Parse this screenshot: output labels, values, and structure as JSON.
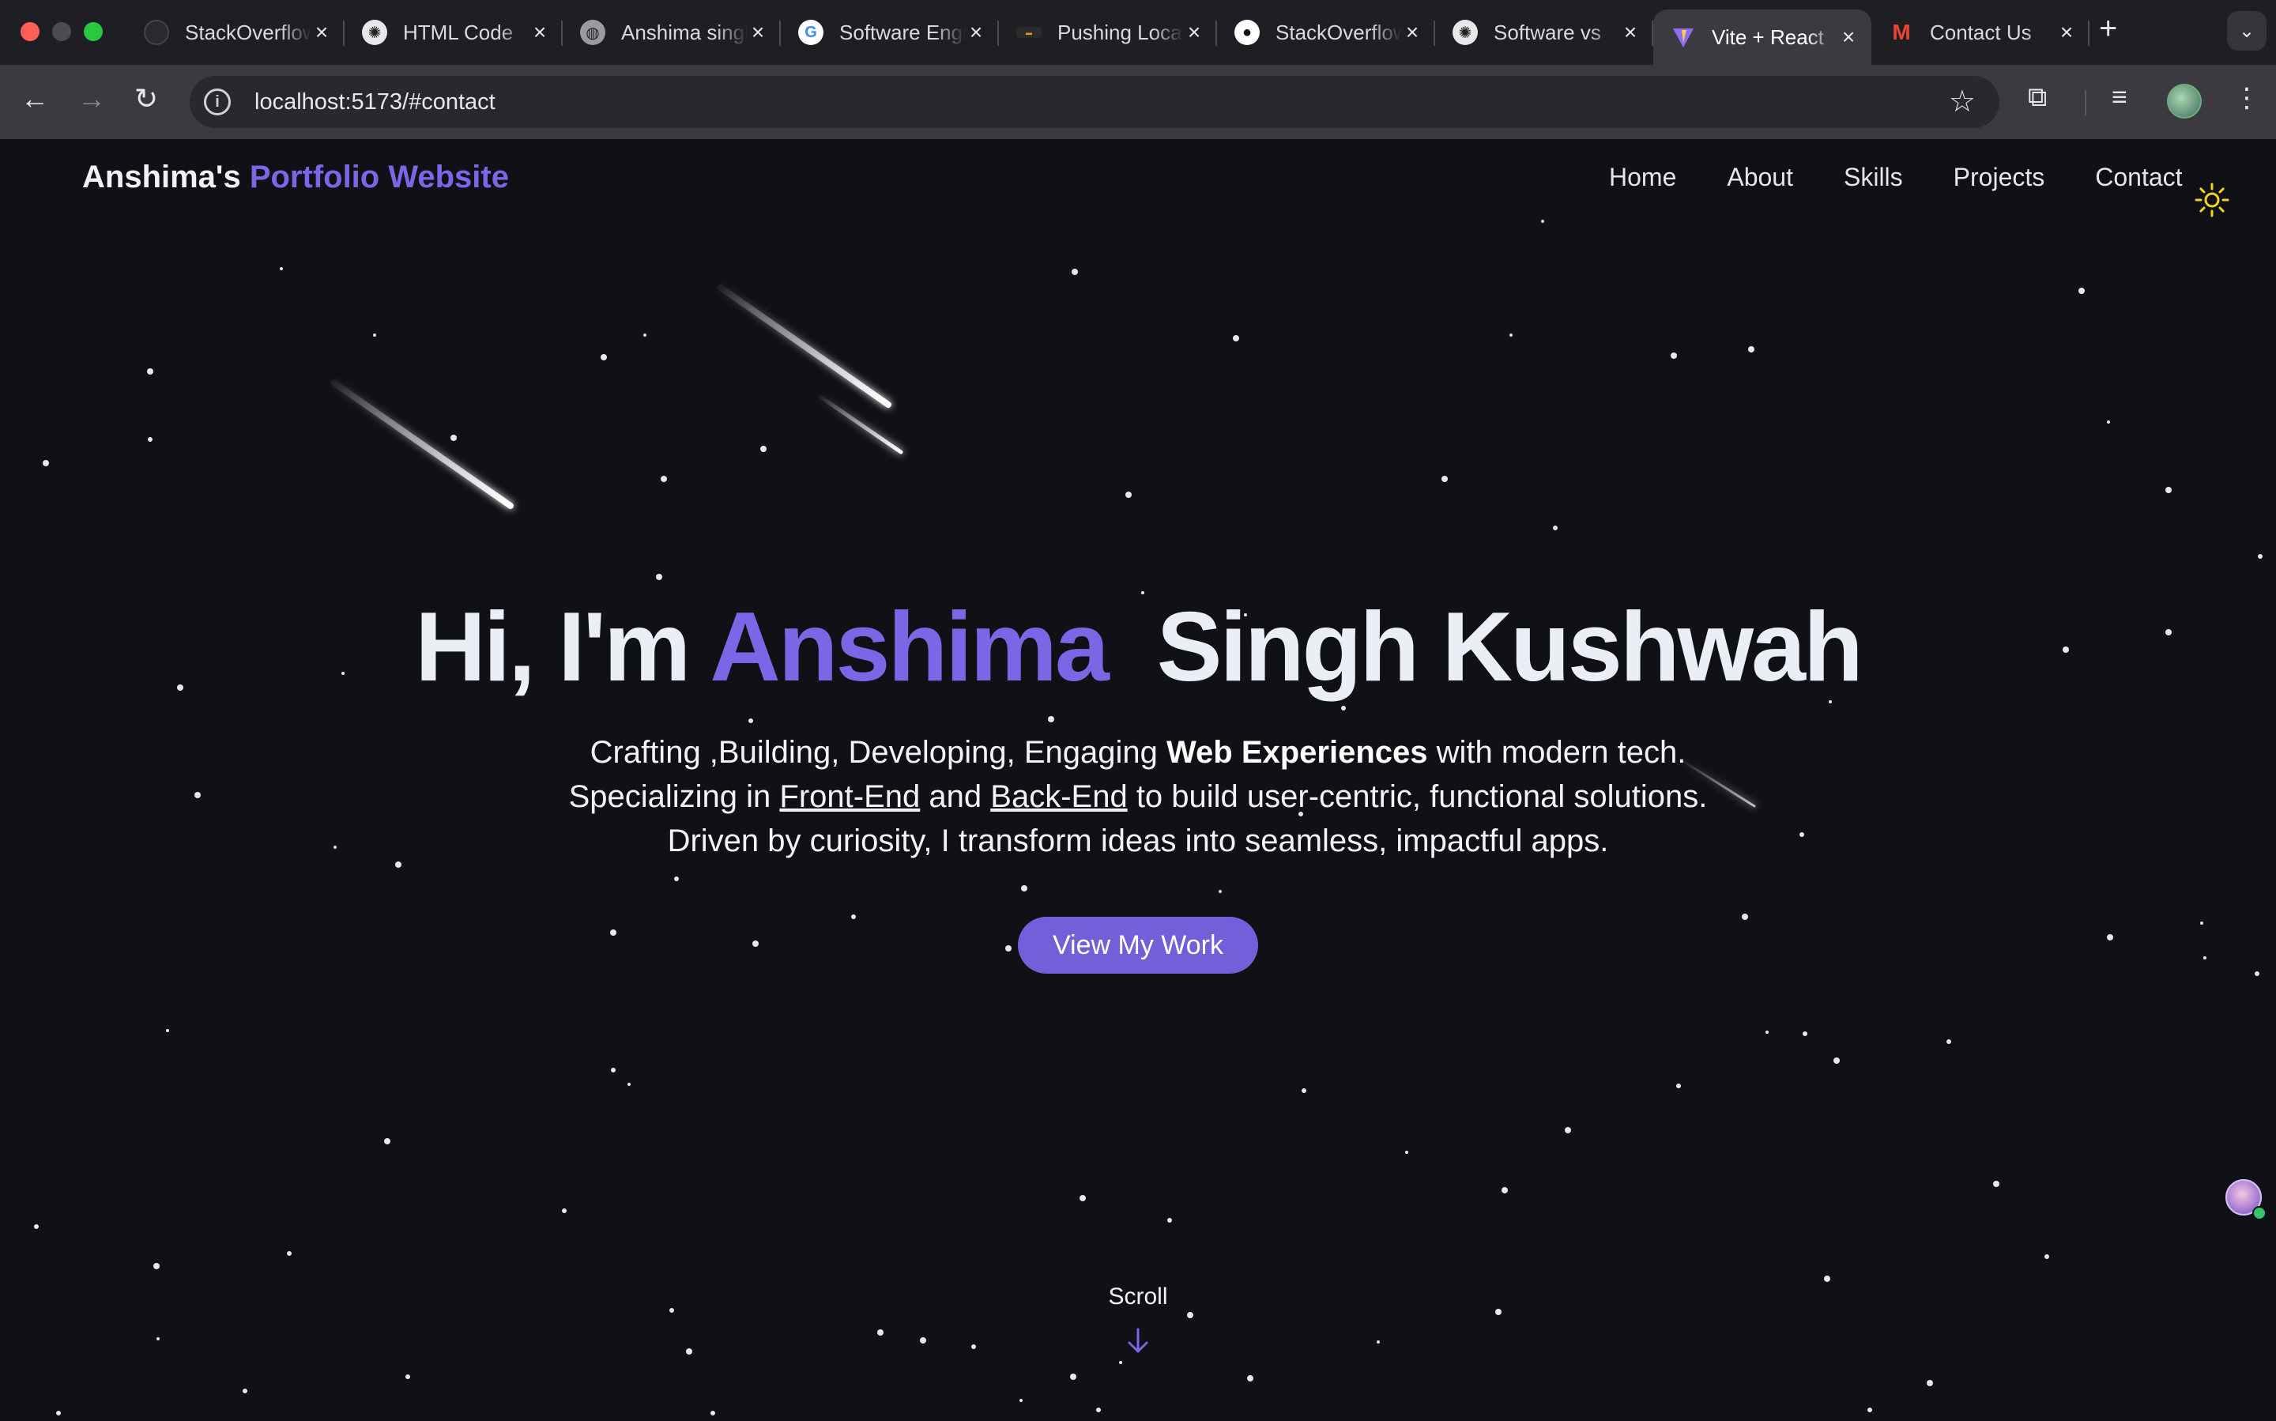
{
  "browser": {
    "tabs": [
      {
        "title": "StackOverflow",
        "favicon": "stackoverflow-icon",
        "active": false
      },
      {
        "title": "HTML Code",
        "favicon": "chatgpt-icon",
        "active": false
      },
      {
        "title": "Anshima singh",
        "favicon": "globe-icon",
        "active": false
      },
      {
        "title": "Software Engineer",
        "favicon": "google-icon",
        "active": false
      },
      {
        "title": "Pushing Local",
        "favicon": "codegrepper-icon",
        "active": false
      },
      {
        "title": "StackOverflow",
        "favicon": "github-icon",
        "active": false
      },
      {
        "title": "Software vs",
        "favicon": "chatgpt-icon",
        "active": false
      },
      {
        "title": "Vite + React",
        "favicon": "vite-icon",
        "active": true
      },
      {
        "title": "Contact Us",
        "favicon": "gmail-icon",
        "active": false
      }
    ],
    "new_tab": "+",
    "tab_menu": "⌄",
    "url": "localhost:5173/#contact"
  },
  "site": {
    "logo_name": "Anshima's",
    "logo_accent": "Portfolio Website",
    "nav": {
      "home": "Home",
      "about": "About",
      "skills": "Skills",
      "projects": "Projects",
      "contact": "Contact"
    },
    "theme_toggle_icon": "sun-icon"
  },
  "hero": {
    "greeting": "Hi, I'm",
    "first_name": "Anshima",
    "last_name": "Singh Kushwah",
    "line1_pre": "Crafting ,Building, Developing, Engaging",
    "line1_bold": "Web Experiences",
    "line1_post": "with modern tech.",
    "line2_pre": "Specializing in",
    "line2_link1": "Front-End",
    "line2_mid": "and",
    "line2_link2": "Back-End",
    "line2_post": "to build user-centric, functional solutions.",
    "line3": "Driven by curiosity, I transform ideas into seamless, impactful apps.",
    "cta_label": "View My Work",
    "scroll_label": "Scroll"
  },
  "colors": {
    "accent": "#7b67e6",
    "button": "#7360d9",
    "background": "#0f1117",
    "sun": "#f5d417"
  }
}
